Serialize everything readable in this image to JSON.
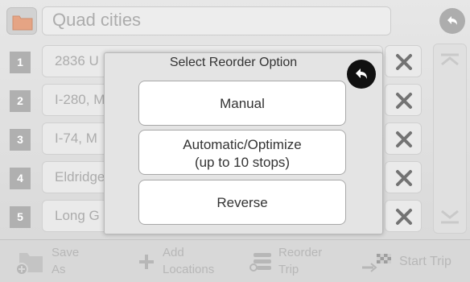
{
  "header": {
    "trip_name": "Quad cities",
    "folder_icon": "folder-icon",
    "back_icon": "back-arrow-icon"
  },
  "stops": [
    {
      "number": "1",
      "address": "2836 U"
    },
    {
      "number": "2",
      "address": "I-280, M"
    },
    {
      "number": "3",
      "address": "I-74, M"
    },
    {
      "number": "4",
      "address": "Eldridge"
    },
    {
      "number": "5",
      "address": "Long G"
    }
  ],
  "bottom_bar": {
    "save_as": {
      "line1": "Save",
      "line2": "As"
    },
    "add_locations": {
      "line1": "Add",
      "line2": "Locations"
    },
    "reorder_trip": {
      "line1": "Reorder",
      "line2": "Trip"
    },
    "start_trip": "Start Trip"
  },
  "modal": {
    "title": "Select Reorder Option",
    "manual": "Manual",
    "auto_line1": "Automatic/Optimize",
    "auto_line2": "(up to 10 stops)",
    "reverse": "Reverse"
  },
  "colors": {
    "accent_folder": "#d9825a",
    "number_badge": "#9f9f9f",
    "delete_x": "#555555",
    "modal_back": "#111111"
  }
}
